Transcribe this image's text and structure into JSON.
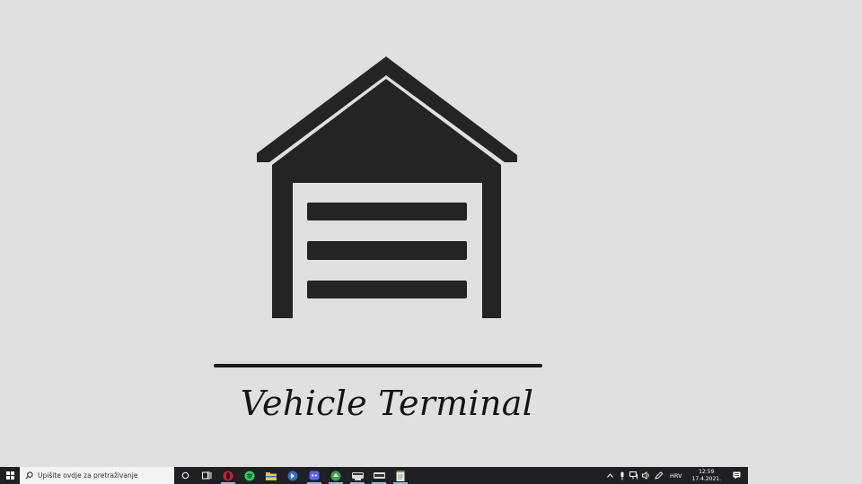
{
  "app": {
    "title": "Vehicle Terminal",
    "logo_icon": "garage-icon"
  },
  "taskbar": {
    "start_icon": "windows-logo-icon",
    "search_placeholder": "Upišite ovdje za pretraživanje",
    "pinned": [
      {
        "icon": "cortana-icon"
      },
      {
        "icon": "task-view-icon"
      },
      {
        "icon": "opera-icon"
      },
      {
        "icon": "spotify-icon"
      },
      {
        "icon": "file-explorer-icon"
      },
      {
        "icon": "app-blue-icon"
      },
      {
        "icon": "discord-icon"
      },
      {
        "icon": "app-green-icon"
      },
      {
        "icon": "window-app-1-icon"
      },
      {
        "icon": "window-app-2-icon"
      },
      {
        "icon": "notepad-icon"
      }
    ],
    "tray": {
      "language": "HRV",
      "time": "12:59",
      "date": "17.4.2021."
    }
  },
  "colors": {
    "background": "#e1e0df",
    "logo": "#242424",
    "taskbar": "#1f1f24"
  }
}
